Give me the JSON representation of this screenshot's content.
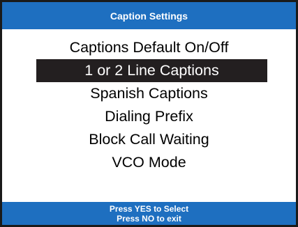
{
  "header": {
    "title": "Caption Settings"
  },
  "menu": {
    "selected_index": 1,
    "items": [
      {
        "label": "Captions Default On/Off"
      },
      {
        "label": "1 or 2 Line Captions"
      },
      {
        "label": "Spanish Captions"
      },
      {
        "label": "Dialing Prefix"
      },
      {
        "label": "Block Call Waiting"
      },
      {
        "label": "VCO Mode"
      }
    ]
  },
  "footer": {
    "line1": "Press YES to Select",
    "line2": "Press NO to exit"
  },
  "colors": {
    "header_bg": "#1e6fc0",
    "footer_bg": "#1e6fc0",
    "selection_bg": "#231f20",
    "border": "#1a1a1a"
  }
}
